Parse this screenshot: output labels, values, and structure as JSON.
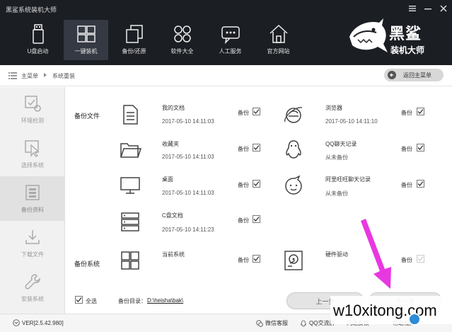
{
  "app_title": "黑鲨系统装机大师",
  "nav": [
    {
      "label": "U盘启动",
      "icon": "usb-drive-icon",
      "active": false
    },
    {
      "label": "一键装机",
      "icon": "windows-logo-icon",
      "active": true
    },
    {
      "label": "备份/还原",
      "icon": "backup-copy-icon",
      "active": false
    },
    {
      "label": "软件大全",
      "icon": "app-grid-icon",
      "active": false
    },
    {
      "label": "人工服务",
      "icon": "chat-bubble-icon",
      "active": false
    },
    {
      "label": "官方网站",
      "icon": "home-icon",
      "active": false
    }
  ],
  "logo": {
    "text": "黑鲨",
    "sub": "装机大师"
  },
  "breadcrumb": {
    "root": "主菜单",
    "current": "系统重装"
  },
  "back_button": "返回主菜单",
  "sidebar": [
    {
      "label": "环境检测",
      "icon": "env-check-icon"
    },
    {
      "label": "选择系统",
      "icon": "select-cursor-icon"
    },
    {
      "label": "备份资料",
      "icon": "backup-data-icon",
      "active": true
    },
    {
      "label": "下载文件",
      "icon": "download-icon"
    },
    {
      "label": "安装系统",
      "icon": "wrench-icon"
    }
  ],
  "sections": {
    "files": "备份文件",
    "system": "备份系统"
  },
  "backup_label": "备份",
  "files_left": [
    {
      "name": "我的文档",
      "date": "2017-05-10 14:11:03",
      "icon": "document-icon"
    },
    {
      "name": "收藏夹",
      "date": "2017-05-10 14:11:03",
      "icon": "folder-icon"
    },
    {
      "name": "桌面",
      "date": "2017-05-10 14:11:03",
      "icon": "monitor-icon"
    },
    {
      "name": "C盘文档",
      "date": "2017-05-10 14:11:23",
      "icon": "drive-stack-icon"
    },
    {
      "name": "当前系统",
      "date": "",
      "icon": "windows-logo-icon"
    }
  ],
  "files_right": [
    {
      "name": "浏览器",
      "date": "2017-05-10 14:11:10",
      "icon": "ie-browser-icon"
    },
    {
      "name": "QQ聊天记录",
      "date": "从未备份",
      "icon": "qq-penguin-icon"
    },
    {
      "name": "阿里旺旺聊天记录",
      "date": "从未备份",
      "icon": "wangwang-icon"
    },
    {
      "name": "硬件驱动",
      "date": "",
      "icon": "hard-disk-icon"
    }
  ],
  "select_all": "全选",
  "backup_dir_label": "备份目录：",
  "backup_dir": "D:\\heisha\\bak\\",
  "prev_button": "上一步",
  "next_button": "下一步",
  "version": "VER[2.5.42.980]",
  "footer": {
    "wechat": "微信客服",
    "qq": "QQ交流群",
    "feedback": "问题反馈",
    "help": "帮助视频"
  },
  "watermark": "w10xitong.com",
  "colors": {
    "header_bg": "#1b1e23",
    "arrow": "#e838e0",
    "watermark_ball": "#2e8bd6"
  }
}
